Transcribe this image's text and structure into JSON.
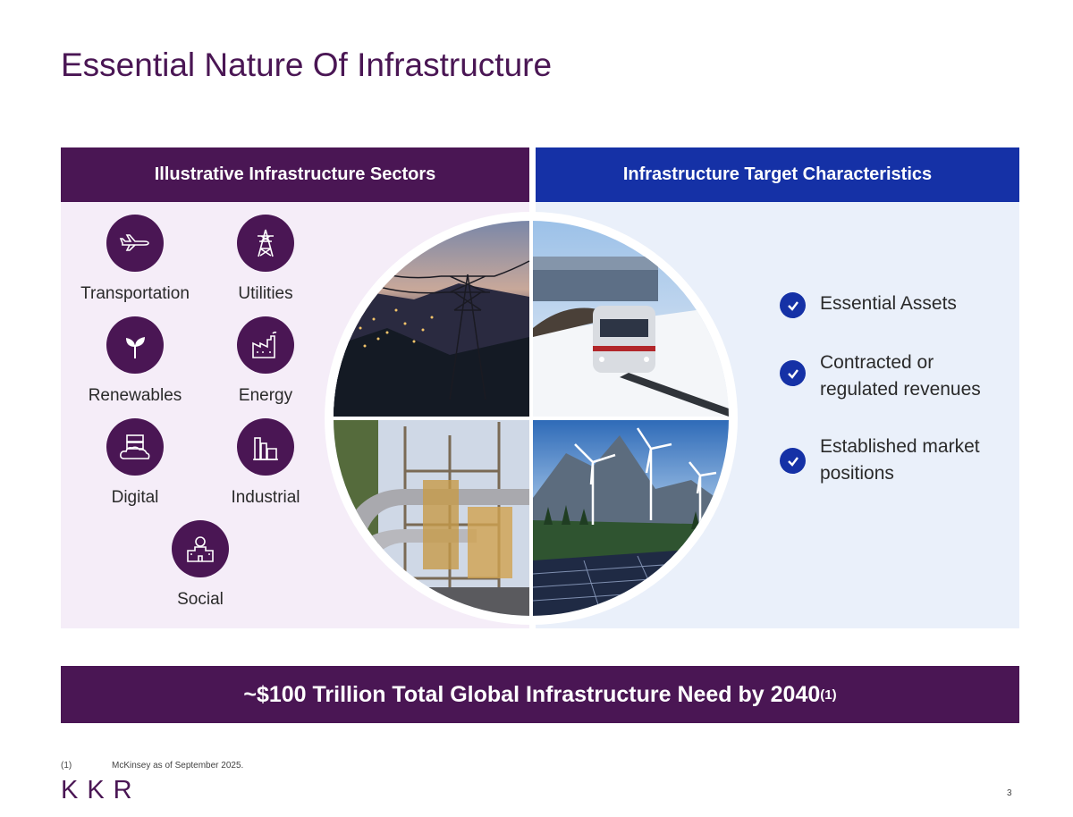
{
  "title": "Essential Nature Of Infrastructure",
  "left_header": "Illustrative Infrastructure Sectors",
  "right_header": "Infrastructure Target Characteristics",
  "sectors": [
    {
      "label": "Transportation",
      "icon": "airplane-icon"
    },
    {
      "label": "Utilities",
      "icon": "power-tower-icon"
    },
    {
      "label": "Renewables",
      "icon": "leaf-sprout-icon"
    },
    {
      "label": "Energy",
      "icon": "factory-icon"
    },
    {
      "label": "Digital",
      "icon": "cloud-server-icon"
    },
    {
      "label": "Industrial",
      "icon": "industrial-plant-icon"
    },
    {
      "label": "Social",
      "icon": "school-building-icon"
    }
  ],
  "photos": [
    "power lines at dusk",
    "commuter train at station",
    "industrial plant",
    "wind turbines and solar panels"
  ],
  "characteristics": [
    "Essential Assets",
    "Contracted or\nregulated revenues",
    "Established market\npositions"
  ],
  "banner": {
    "text": "~$100 Trillion Total Global Infrastructure Need by 2040",
    "note": "(1)"
  },
  "footnote": {
    "marker": "(1)",
    "text": "McKinsey as of September 2025."
  },
  "logo": "KKR",
  "page_number": "3",
  "colors": {
    "purple": "#4a1654",
    "blue": "#1531a6",
    "left_panel": "#f5edf8",
    "right_panel": "#eaf0fa"
  }
}
